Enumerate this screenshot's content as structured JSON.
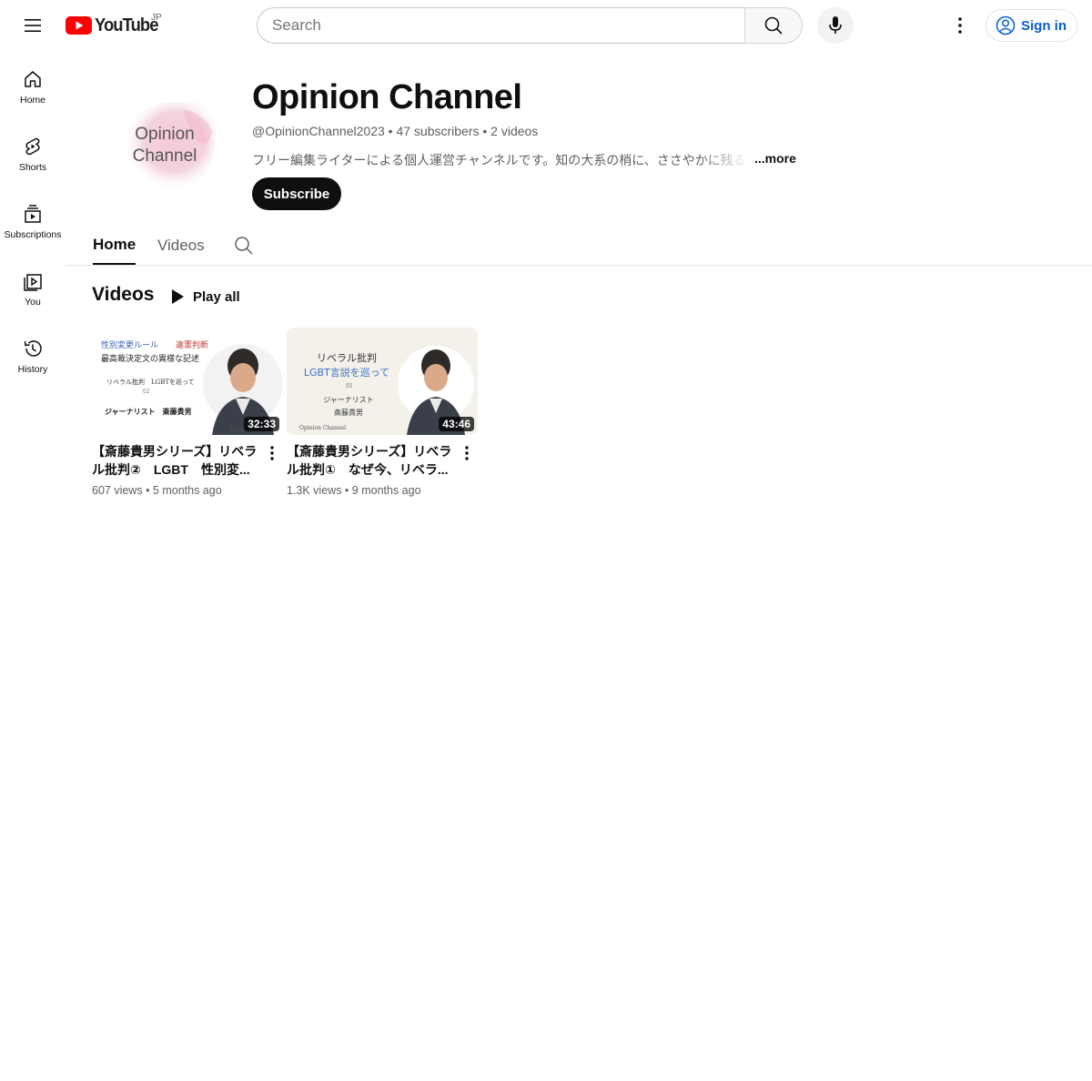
{
  "header": {
    "logo_text": "YouTube",
    "region": "JP",
    "search_placeholder": "Search",
    "signin_label": "Sign in"
  },
  "sidebar": {
    "items": [
      {
        "label": "Home",
        "icon": "home-icon"
      },
      {
        "label": "Shorts",
        "icon": "shorts-icon"
      },
      {
        "label": "Subscriptions",
        "icon": "subscriptions-icon"
      },
      {
        "label": "You",
        "icon": "you-icon"
      },
      {
        "label": "History",
        "icon": "history-icon"
      }
    ]
  },
  "channel": {
    "avatar_line1": "Opinion",
    "avatar_line2": "Channel",
    "name": "Opinion Channel",
    "meta": "@OpinionChannel2023 • 47 subscribers • 2 videos",
    "description": "フリー編集ライターによる個人運営チャンネルです。知の大系の梢に、ささやかに残る",
    "more_label": "...more",
    "subscribe_label": "Subscribe"
  },
  "tabs": [
    {
      "label": "Home",
      "active": true
    },
    {
      "label": "Videos",
      "active": false
    }
  ],
  "section": {
    "title": "Videos",
    "play_all_label": "Play all"
  },
  "videos": [
    {
      "title": "【斎藤貴男シリーズ】リベラル批判②　LGBT　性別変...",
      "duration": "32:33",
      "views": "607 views",
      "age": "5 months ago",
      "thumb": {
        "line1a": "性別変更ルール",
        "line1b": "違憲判断",
        "line2": "最高裁決定文の異様な記述",
        "line3": "リベラル批判　LGBTを巡って",
        "line4": "02",
        "line5": "ジャーナリスト　斎藤貴男",
        "footer": "Opin"
      }
    },
    {
      "title": "【斎藤貴男シリーズ】リベラル批判①　なぜ今、リベラ...",
      "duration": "43:46",
      "views": "1.3K views",
      "age": "9 months ago",
      "thumb": {
        "line1": "リベラル批判",
        "line2": "LGBT言説を巡って",
        "line3": "01",
        "line4": "ジャーナリスト",
        "line5": "斎藤貴男",
        "footer": "Opinion Channel"
      }
    }
  ],
  "colors": {
    "brand_red": "#ff0000",
    "link_blue": "#065fd4",
    "text_primary": "#0f0f0f",
    "text_secondary": "#606060"
  }
}
